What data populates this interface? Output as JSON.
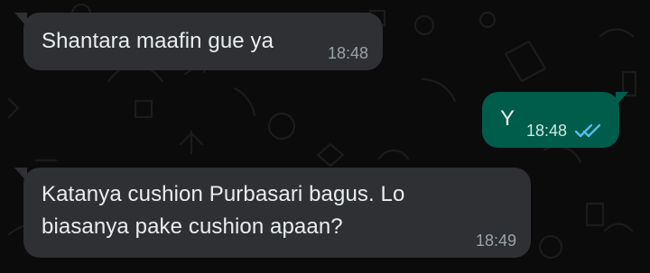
{
  "chat": {
    "messages": [
      {
        "direction": "incoming",
        "text": "Shantara maafin gue ya",
        "time": "18:48"
      },
      {
        "direction": "outgoing",
        "text": "Y",
        "time": "18:48",
        "status_icon": "double-check-icon",
        "status_color": "#53bdeb"
      },
      {
        "direction": "incoming",
        "text": "Katanya cushion Purbasari bagus. Lo\nbiasanya pake cushion apaan?",
        "time": "18:49"
      }
    ]
  },
  "theme": {
    "background": "#0b0b0b",
    "incoming_bubble": "#2f3034",
    "outgoing_bubble": "#005c4b",
    "text": "#e9edef"
  }
}
